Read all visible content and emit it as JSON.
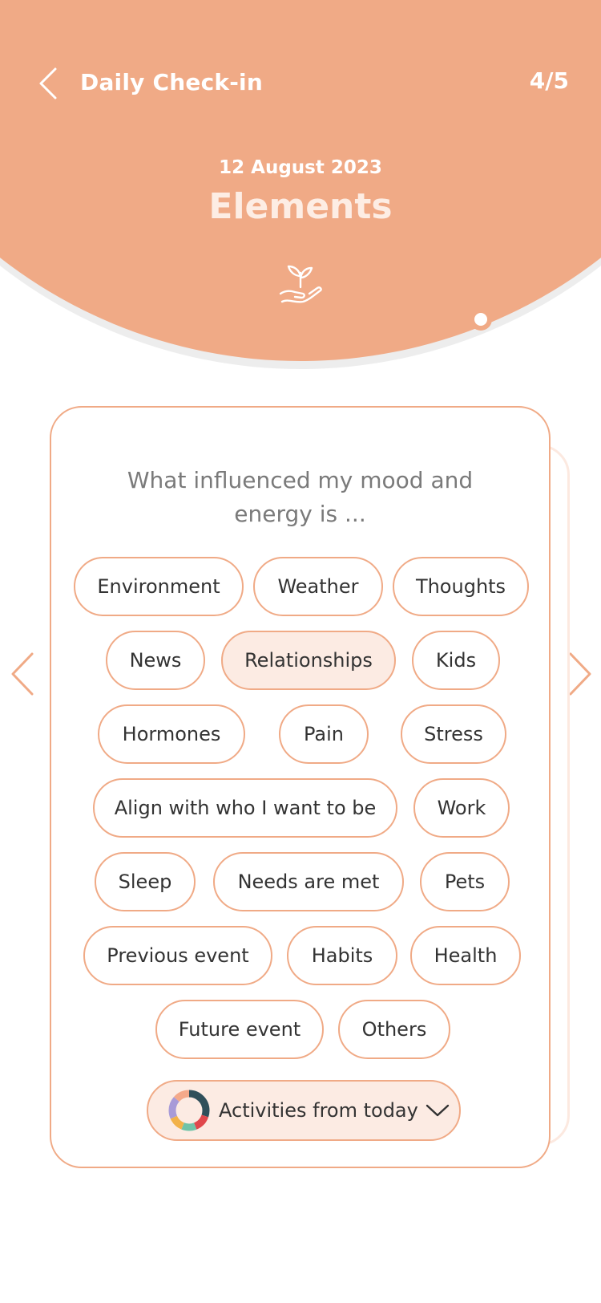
{
  "header": {
    "title": "Daily Check-in",
    "progress": "4/5",
    "date": "12 August 2023",
    "section": "Elements",
    "icon": "sprout-in-hand-icon"
  },
  "card": {
    "question": "What influenced my mood and energy is ...",
    "chips": [
      {
        "label": "Environment",
        "selected": false
      },
      {
        "label": "Weather",
        "selected": false
      },
      {
        "label": "Thoughts",
        "selected": false
      },
      {
        "label": "News",
        "selected": false
      },
      {
        "label": "Relationships",
        "selected": true
      },
      {
        "label": "Kids",
        "selected": false
      },
      {
        "label": "Hormones",
        "selected": false
      },
      {
        "label": "Pain",
        "selected": false
      },
      {
        "label": "Stress",
        "selected": false
      },
      {
        "label": "Align with who I want to be",
        "selected": false
      },
      {
        "label": "Work",
        "selected": false
      },
      {
        "label": "Sleep",
        "selected": false
      },
      {
        "label": "Needs are met",
        "selected": false
      },
      {
        "label": "Pets",
        "selected": false
      },
      {
        "label": "Previous event",
        "selected": false
      },
      {
        "label": "Habits",
        "selected": false
      },
      {
        "label": "Health",
        "selected": false
      },
      {
        "label": "Future event",
        "selected": false
      },
      {
        "label": "Others",
        "selected": false
      }
    ],
    "activities_label": "Activities from today"
  },
  "colors": {
    "accent": "#F0AA86",
    "selected_chip": "#FCEBE3",
    "title_soft": "#FDEDE4"
  }
}
